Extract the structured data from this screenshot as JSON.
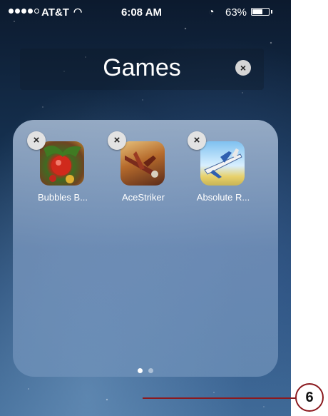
{
  "status_bar": {
    "carrier": "AT&T",
    "time": "6:08 AM",
    "battery": "63%",
    "battery_level": 0.63,
    "signal_bars_filled": 4,
    "signal_bars_total": 5
  },
  "folder": {
    "title": "Games",
    "title_clear_glyph": "×",
    "apps": [
      {
        "label": "Bubbles B...",
        "icon": "bubbles-game-icon"
      },
      {
        "label": "AceStriker",
        "icon": "fighter-plane-icon"
      },
      {
        "label": "Absolute R...",
        "icon": "rc-airplane-icon"
      }
    ],
    "delete_glyph": "×",
    "page_count": 2,
    "current_page": 1
  },
  "callout": {
    "number": "6"
  },
  "colors": {
    "callout": "#8b1a1f",
    "text": "#ffffff"
  }
}
